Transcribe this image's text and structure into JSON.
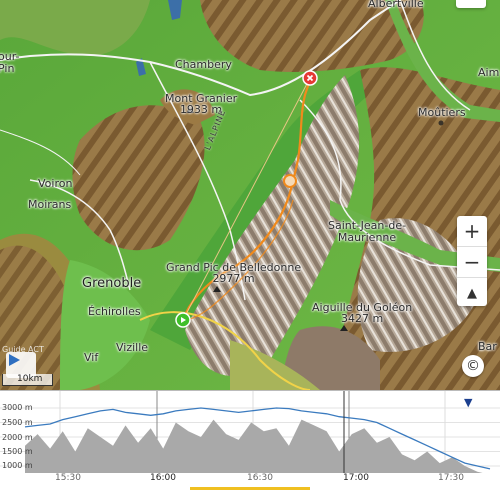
{
  "map": {
    "places": {
      "albertville": "Albertville",
      "chambery": "Chambery",
      "aim": "Aim",
      "mont_granier_name": "Mont Granier",
      "mont_granier_elev": "1933 m",
      "moutiers": "Moûtiers",
      "voiron": "Voiron",
      "moirans": "Moirans",
      "saint_jean_1": "Saint-Jean-de-",
      "saint_jean_2": "Maurienne",
      "grenoble": "Grenoble",
      "echirolles": "Échirolles",
      "grand_pic_name": "Grand Pic de Belledonne",
      "grand_pic_elev": "2977 m",
      "aiguille_name": "Aiguille du Goléon",
      "aiguille_elev": "3427 m",
      "vizille": "Vizille",
      "vif": "Vif",
      "bar": "Bar",
      "our_pin": "our-\nPin",
      "road": "L'ALPINE"
    },
    "scale_label": "10km",
    "hint_text": "Guide ACT",
    "controls": {
      "zoom_in": "+",
      "zoom_out": "−",
      "north": "▲",
      "copyright": "©"
    },
    "colors": {
      "track": "#f08a1c",
      "start": "#3fbf2a",
      "end": "#e53935"
    }
  },
  "profile": {
    "elevation_labels": [
      "3000 m",
      "2500 m",
      "2000 m",
      "1500 m",
      "1000 m"
    ],
    "time_labels": [
      "15:30",
      "16:00",
      "16:30",
      "17:00",
      "17:30"
    ],
    "dropdown_icon": "▼",
    "altitude_series": [
      2350,
      2400,
      2450,
      2600,
      2700,
      2800,
      2900,
      2950,
      2850,
      2800,
      2750,
      2800,
      2900,
      2950,
      3000,
      2950,
      2900,
      2850,
      2900,
      2950,
      3000,
      2980,
      2900,
      2850,
      2800,
      2700,
      2650,
      2600,
      2500,
      2300,
      2100,
      1900,
      1700,
      1500,
      1300,
      1100,
      1000,
      900
    ],
    "ground_series": [
      1700,
      2100,
      1600,
      2200,
      1500,
      2300,
      2000,
      1700,
      2400,
      1800,
      2300,
      1600,
      2500,
      2200,
      2000,
      2600,
      2100,
      1900,
      2500,
      2200,
      2300,
      1700,
      2600,
      2400,
      2200,
      1500,
      2100,
      2300,
      1800,
      2000,
      1400,
      1200,
      1500,
      1100,
      1300,
      1000,
      800,
      700
    ]
  }
}
